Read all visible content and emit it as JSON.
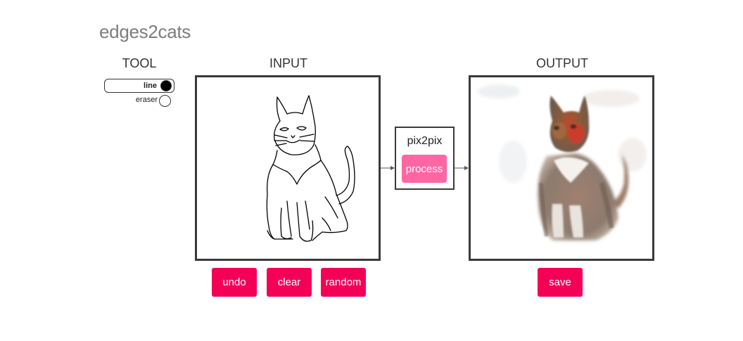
{
  "app": {
    "title": "edges2cats"
  },
  "tool": {
    "heading": "TOOL",
    "options": [
      {
        "label": "line",
        "selected": true
      },
      {
        "label": "eraser",
        "selected": false
      }
    ]
  },
  "input": {
    "heading": "INPUT"
  },
  "output": {
    "heading": "OUTPUT"
  },
  "model": {
    "name": "pix2pix",
    "process_label": "process"
  },
  "buttons": {
    "undo": "undo",
    "clear": "clear",
    "random": "random",
    "save": "save"
  },
  "colors": {
    "accent": "#f50057",
    "process": "#ff66a3",
    "border": "#3a3a3a",
    "title": "#7d7d7d"
  }
}
